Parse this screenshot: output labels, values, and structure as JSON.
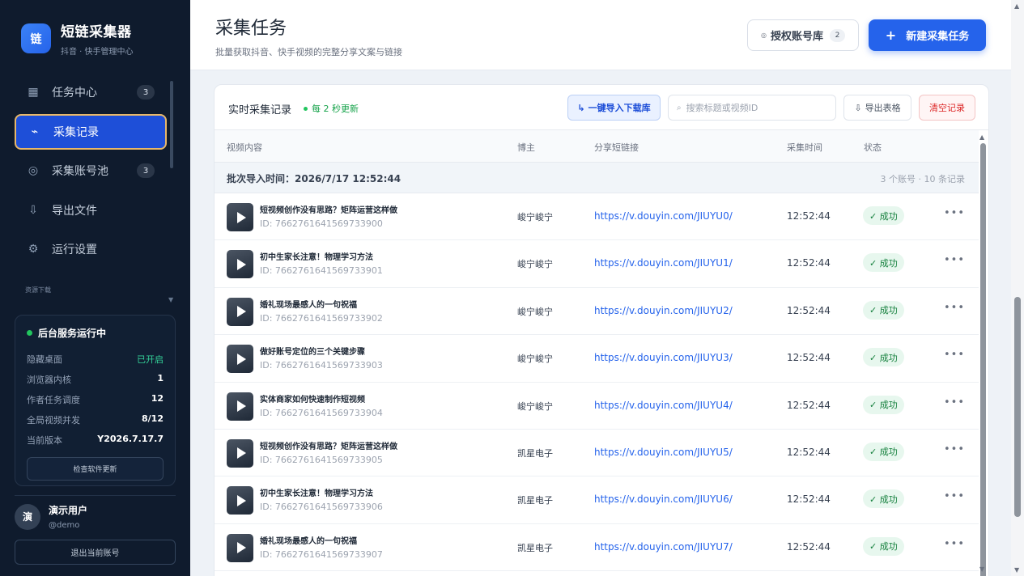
{
  "brand": {
    "logo_char": "链",
    "title": "短链采集器",
    "subtitle": "抖音 · 快手管理中心"
  },
  "nav": [
    {
      "label": "任务中心",
      "icon": "grid-icon",
      "glyph": "▦",
      "badge": "3",
      "active": false
    },
    {
      "label": "采集记录",
      "icon": "activity-icon",
      "glyph": "⌁",
      "badge": "",
      "active": true
    },
    {
      "label": "采集账号池",
      "icon": "target-icon",
      "glyph": "◎",
      "badge": "3",
      "active": false
    },
    {
      "label": "导出文件",
      "icon": "download-icon",
      "glyph": "⇩",
      "badge": "",
      "active": false
    },
    {
      "label": "运行设置",
      "icon": "gear-icon",
      "glyph": "⚙",
      "badge": "",
      "active": false
    }
  ],
  "section_title": "资源下载",
  "status": {
    "title": "后台服务运行中",
    "rows": [
      {
        "k": "隐藏桌面",
        "v": "已开启",
        "green": true
      },
      {
        "k": "浏览器内核",
        "v": "1",
        "green": false
      },
      {
        "k": "作者任务调度",
        "v": "12",
        "green": false
      },
      {
        "k": "全局视频并发",
        "v": "8/12",
        "green": false
      },
      {
        "k": "当前版本",
        "v": "Y2026.7.17.7",
        "green": false
      }
    ],
    "check_update": "检查软件更新"
  },
  "user": {
    "avatar": "演",
    "name": "演示用户",
    "handle": "@demo",
    "logout": "退出当前账号"
  },
  "header": {
    "title": "采集任务",
    "subtitle": "批量获取抖音、快手视频的完整分享文案与链接",
    "auth_button": "授权账号库",
    "auth_count": "2",
    "new_task_button": "新建采集任务"
  },
  "records": {
    "title": "实时采集记录",
    "live": "每 2 秒更新",
    "import_button": "一键导入下载库",
    "search_placeholder": "搜索标题或视频ID",
    "export_button": "导出表格",
    "clear_button": "清空记录",
    "columns": [
      "视频内容",
      "博主",
      "分享短链接",
      "采集时间",
      "状态"
    ],
    "batch_label": "批次导入时间：2026/7/17 12:52:44",
    "batch_meta": "3 个账号 · 10 条记录",
    "rows": [
      {
        "title": "短视频创作没有思路？矩阵运营这样做",
        "id": "ID: 7662761641569733900",
        "author": "峻宁峻宁",
        "link": "https://v.douyin.com/JIUYU0/",
        "time": "12:52:44",
        "status": "✓ 成功"
      },
      {
        "title": "初中生家长注意！物理学习方法",
        "id": "ID: 7662761641569733901",
        "author": "峻宁峻宁",
        "link": "https://v.douyin.com/JIUYU1/",
        "time": "12:52:44",
        "status": "✓ 成功"
      },
      {
        "title": "婚礼现场最感人的一句祝福",
        "id": "ID: 7662761641569733902",
        "author": "峻宁峻宁",
        "link": "https://v.douyin.com/JIUYU2/",
        "time": "12:52:44",
        "status": "✓ 成功"
      },
      {
        "title": "做好账号定位的三个关键步骤",
        "id": "ID: 7662761641569733903",
        "author": "峻宁峻宁",
        "link": "https://v.douyin.com/JIUYU3/",
        "time": "12:52:44",
        "status": "✓ 成功"
      },
      {
        "title": "实体商家如何快速制作短视频",
        "id": "ID: 7662761641569733904",
        "author": "峻宁峻宁",
        "link": "https://v.douyin.com/JIUYU4/",
        "time": "12:52:44",
        "status": "✓ 成功"
      },
      {
        "title": "短视频创作没有思路？矩阵运营这样做",
        "id": "ID: 7662761641569733905",
        "author": "凯星电子",
        "link": "https://v.douyin.com/JIUYU5/",
        "time": "12:52:44",
        "status": "✓ 成功"
      },
      {
        "title": "初中生家长注意！物理学习方法",
        "id": "ID: 7662761641569733906",
        "author": "凯星电子",
        "link": "https://v.douyin.com/JIUYU6/",
        "time": "12:52:44",
        "status": "✓ 成功"
      },
      {
        "title": "婚礼现场最感人的一句祝福",
        "id": "ID: 7662761641569733907",
        "author": "凯星电子",
        "link": "https://v.douyin.com/JIUYU7/",
        "time": "12:52:44",
        "status": "✓ 成功"
      }
    ]
  }
}
